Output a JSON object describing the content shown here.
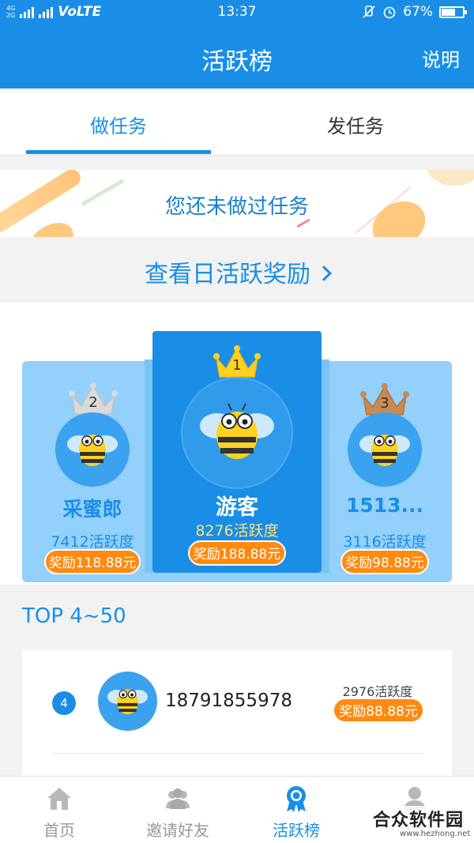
{
  "status_bar": {
    "network_top": "4G",
    "network_bottom": "2G",
    "volte": "VoLTE",
    "time": "13:37",
    "battery": "67%",
    "battery_level": 0.67
  },
  "header": {
    "title": "活跃榜",
    "help_label": "说明"
  },
  "tabs": [
    {
      "label": "做任务",
      "active": true
    },
    {
      "label": "发任务",
      "active": false
    }
  ],
  "banner": {
    "text": "您还未做过任务"
  },
  "daily_reward": {
    "label": "查看日活跃奖励"
  },
  "podium": {
    "first": {
      "rank": "1",
      "name": "游客",
      "score": "8276活跃度",
      "reward": "奖励188.88元"
    },
    "second": {
      "rank": "2",
      "name": "采蜜郎",
      "score": "7412活跃度",
      "reward": "奖励118.88元"
    },
    "third": {
      "rank": "3",
      "name": "1513...",
      "score": "3116活跃度",
      "reward": "奖励98.88元"
    }
  },
  "top_list": {
    "title": "TOP 4~50",
    "rows": [
      {
        "rank": "4",
        "name": "18791855978",
        "score": "2976活跃度",
        "reward": "奖励88.88元"
      }
    ]
  },
  "bottom_nav": [
    {
      "label": "首页",
      "icon": "home-icon",
      "active": false
    },
    {
      "label": "邀请好友",
      "icon": "people-icon",
      "active": false
    },
    {
      "label": "活跃榜",
      "icon": "medal-icon",
      "active": true
    },
    {
      "label": "我的",
      "icon": "user-icon",
      "active": false
    }
  ],
  "watermark": {
    "title": "合众软件园",
    "url": "www.hezhong.net"
  },
  "colors": {
    "primary": "#1a8ee6",
    "reward": "#ff8a10",
    "gold_text": "#ffe27a"
  }
}
